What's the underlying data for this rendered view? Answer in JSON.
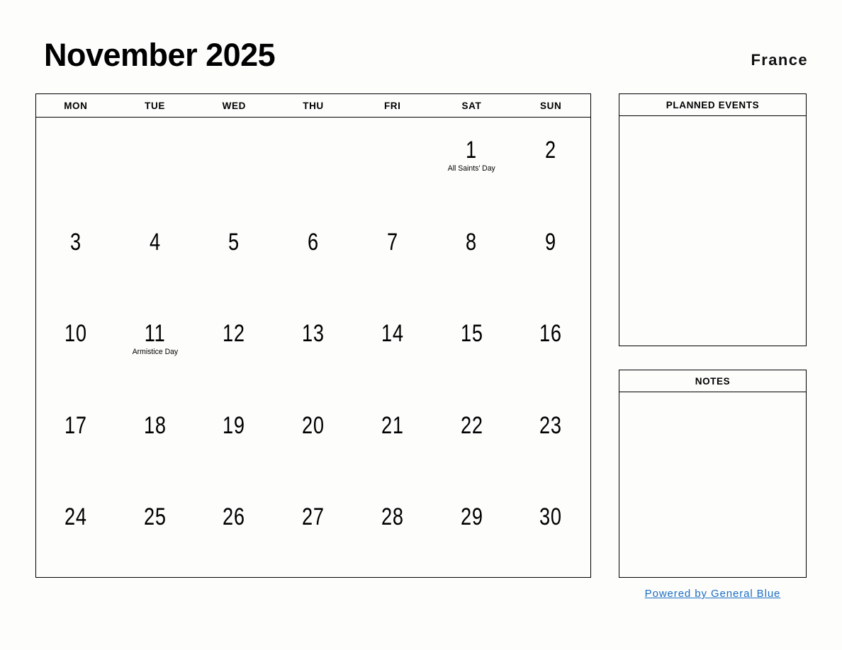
{
  "header": {
    "month_title": "November 2025",
    "country": "France"
  },
  "calendar": {
    "weekdays": [
      "MON",
      "TUE",
      "WED",
      "THU",
      "FRI",
      "SAT",
      "SUN"
    ],
    "weeks": [
      [
        {
          "day": "",
          "event": ""
        },
        {
          "day": "",
          "event": ""
        },
        {
          "day": "",
          "event": ""
        },
        {
          "day": "",
          "event": ""
        },
        {
          "day": "",
          "event": ""
        },
        {
          "day": "1",
          "event": "All Saints’ Day"
        },
        {
          "day": "2",
          "event": ""
        }
      ],
      [
        {
          "day": "3",
          "event": ""
        },
        {
          "day": "4",
          "event": ""
        },
        {
          "day": "5",
          "event": ""
        },
        {
          "day": "6",
          "event": ""
        },
        {
          "day": "7",
          "event": ""
        },
        {
          "day": "8",
          "event": ""
        },
        {
          "day": "9",
          "event": ""
        }
      ],
      [
        {
          "day": "10",
          "event": ""
        },
        {
          "day": "11",
          "event": "Armistice Day"
        },
        {
          "day": "12",
          "event": ""
        },
        {
          "day": "13",
          "event": ""
        },
        {
          "day": "14",
          "event": ""
        },
        {
          "day": "15",
          "event": ""
        },
        {
          "day": "16",
          "event": ""
        }
      ],
      [
        {
          "day": "17",
          "event": ""
        },
        {
          "day": "18",
          "event": ""
        },
        {
          "day": "19",
          "event": ""
        },
        {
          "day": "20",
          "event": ""
        },
        {
          "day": "21",
          "event": ""
        },
        {
          "day": "22",
          "event": ""
        },
        {
          "day": "23",
          "event": ""
        }
      ],
      [
        {
          "day": "24",
          "event": ""
        },
        {
          "day": "25",
          "event": ""
        },
        {
          "day": "26",
          "event": ""
        },
        {
          "day": "27",
          "event": ""
        },
        {
          "day": "28",
          "event": ""
        },
        {
          "day": "29",
          "event": ""
        },
        {
          "day": "30",
          "event": ""
        }
      ]
    ]
  },
  "panels": {
    "planned_events_title": "PLANNED EVENTS",
    "notes_title": "NOTES"
  },
  "footer": {
    "link_label": "Powered by General Blue"
  },
  "colors": {
    "background": "#fdfdfc",
    "border": "#000000",
    "text": "#000000",
    "link": "#1a6fc4"
  }
}
